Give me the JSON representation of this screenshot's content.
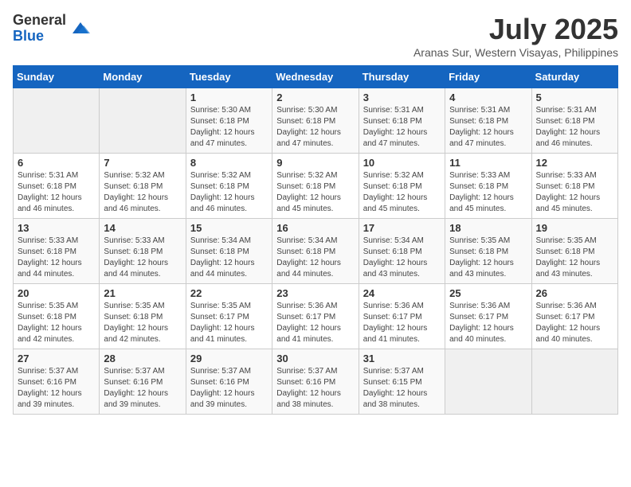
{
  "logo": {
    "general": "General",
    "blue": "Blue"
  },
  "title": "July 2025",
  "subtitle": "Aranas Sur, Western Visayas, Philippines",
  "headers": [
    "Sunday",
    "Monday",
    "Tuesday",
    "Wednesday",
    "Thursday",
    "Friday",
    "Saturday"
  ],
  "weeks": [
    [
      {
        "day": "",
        "info": ""
      },
      {
        "day": "",
        "info": ""
      },
      {
        "day": "1",
        "info": "Sunrise: 5:30 AM\nSunset: 6:18 PM\nDaylight: 12 hours and 47 minutes."
      },
      {
        "day": "2",
        "info": "Sunrise: 5:30 AM\nSunset: 6:18 PM\nDaylight: 12 hours and 47 minutes."
      },
      {
        "day": "3",
        "info": "Sunrise: 5:31 AM\nSunset: 6:18 PM\nDaylight: 12 hours and 47 minutes."
      },
      {
        "day": "4",
        "info": "Sunrise: 5:31 AM\nSunset: 6:18 PM\nDaylight: 12 hours and 47 minutes."
      },
      {
        "day": "5",
        "info": "Sunrise: 5:31 AM\nSunset: 6:18 PM\nDaylight: 12 hours and 46 minutes."
      }
    ],
    [
      {
        "day": "6",
        "info": "Sunrise: 5:31 AM\nSunset: 6:18 PM\nDaylight: 12 hours and 46 minutes."
      },
      {
        "day": "7",
        "info": "Sunrise: 5:32 AM\nSunset: 6:18 PM\nDaylight: 12 hours and 46 minutes."
      },
      {
        "day": "8",
        "info": "Sunrise: 5:32 AM\nSunset: 6:18 PM\nDaylight: 12 hours and 46 minutes."
      },
      {
        "day": "9",
        "info": "Sunrise: 5:32 AM\nSunset: 6:18 PM\nDaylight: 12 hours and 45 minutes."
      },
      {
        "day": "10",
        "info": "Sunrise: 5:32 AM\nSunset: 6:18 PM\nDaylight: 12 hours and 45 minutes."
      },
      {
        "day": "11",
        "info": "Sunrise: 5:33 AM\nSunset: 6:18 PM\nDaylight: 12 hours and 45 minutes."
      },
      {
        "day": "12",
        "info": "Sunrise: 5:33 AM\nSunset: 6:18 PM\nDaylight: 12 hours and 45 minutes."
      }
    ],
    [
      {
        "day": "13",
        "info": "Sunrise: 5:33 AM\nSunset: 6:18 PM\nDaylight: 12 hours and 44 minutes."
      },
      {
        "day": "14",
        "info": "Sunrise: 5:33 AM\nSunset: 6:18 PM\nDaylight: 12 hours and 44 minutes."
      },
      {
        "day": "15",
        "info": "Sunrise: 5:34 AM\nSunset: 6:18 PM\nDaylight: 12 hours and 44 minutes."
      },
      {
        "day": "16",
        "info": "Sunrise: 5:34 AM\nSunset: 6:18 PM\nDaylight: 12 hours and 44 minutes."
      },
      {
        "day": "17",
        "info": "Sunrise: 5:34 AM\nSunset: 6:18 PM\nDaylight: 12 hours and 43 minutes."
      },
      {
        "day": "18",
        "info": "Sunrise: 5:35 AM\nSunset: 6:18 PM\nDaylight: 12 hours and 43 minutes."
      },
      {
        "day": "19",
        "info": "Sunrise: 5:35 AM\nSunset: 6:18 PM\nDaylight: 12 hours and 43 minutes."
      }
    ],
    [
      {
        "day": "20",
        "info": "Sunrise: 5:35 AM\nSunset: 6:18 PM\nDaylight: 12 hours and 42 minutes."
      },
      {
        "day": "21",
        "info": "Sunrise: 5:35 AM\nSunset: 6:18 PM\nDaylight: 12 hours and 42 minutes."
      },
      {
        "day": "22",
        "info": "Sunrise: 5:35 AM\nSunset: 6:17 PM\nDaylight: 12 hours and 41 minutes."
      },
      {
        "day": "23",
        "info": "Sunrise: 5:36 AM\nSunset: 6:17 PM\nDaylight: 12 hours and 41 minutes."
      },
      {
        "day": "24",
        "info": "Sunrise: 5:36 AM\nSunset: 6:17 PM\nDaylight: 12 hours and 41 minutes."
      },
      {
        "day": "25",
        "info": "Sunrise: 5:36 AM\nSunset: 6:17 PM\nDaylight: 12 hours and 40 minutes."
      },
      {
        "day": "26",
        "info": "Sunrise: 5:36 AM\nSunset: 6:17 PM\nDaylight: 12 hours and 40 minutes."
      }
    ],
    [
      {
        "day": "27",
        "info": "Sunrise: 5:37 AM\nSunset: 6:16 PM\nDaylight: 12 hours and 39 minutes."
      },
      {
        "day": "28",
        "info": "Sunrise: 5:37 AM\nSunset: 6:16 PM\nDaylight: 12 hours and 39 minutes."
      },
      {
        "day": "29",
        "info": "Sunrise: 5:37 AM\nSunset: 6:16 PM\nDaylight: 12 hours and 39 minutes."
      },
      {
        "day": "30",
        "info": "Sunrise: 5:37 AM\nSunset: 6:16 PM\nDaylight: 12 hours and 38 minutes."
      },
      {
        "day": "31",
        "info": "Sunrise: 5:37 AM\nSunset: 6:15 PM\nDaylight: 12 hours and 38 minutes."
      },
      {
        "day": "",
        "info": ""
      },
      {
        "day": "",
        "info": ""
      }
    ]
  ]
}
